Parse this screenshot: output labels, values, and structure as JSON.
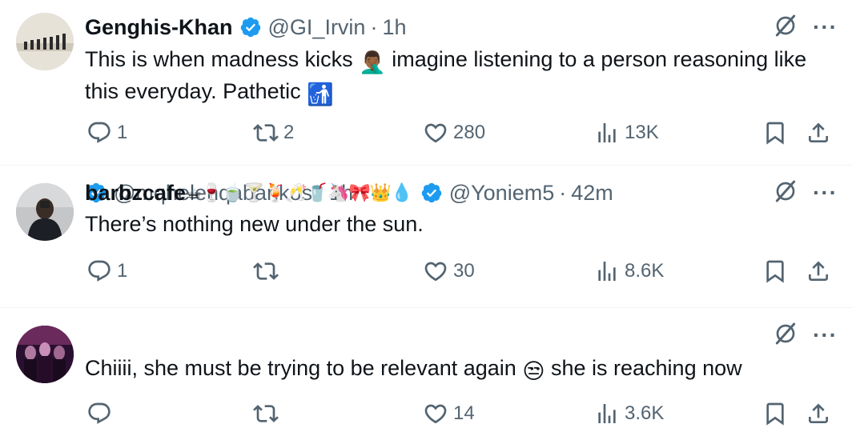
{
  "tweets": [
    {
      "name": "Genghis-Khan",
      "handle": "@GI_Irvin",
      "time": "1h",
      "text_before": "This is when madness kicks",
      "emoji_1": "🤦🏾‍♂️",
      "text_middle": "imagine listening to a person reasoning like this everyday. Pathetic",
      "emoji_2": "🚮",
      "replies": "1",
      "retweets": "2",
      "likes": "280",
      "views": "13K"
    },
    {
      "name": "",
      "handle": "@mqhelenqabankos",
      "time": "1h",
      "text": "There’s nothing new under the sun.",
      "replies": "1",
      "retweets": "",
      "likes": "30",
      "views": "8.6K"
    },
    {
      "name": "barbzcafe",
      "name_emojis": "☕🍷🍵🍸🍹🥂🥤🦄🎀👑💧",
      "handle": "@Yoniem5",
      "time": "42m",
      "text_before": "Chiiii, she must be trying to be relevant again",
      "emoji": "😒",
      "text_after": "she is reaching now",
      "replies": "",
      "retweets": "",
      "likes": "14",
      "views": "3.6K"
    }
  ],
  "colors": {
    "text": "#0f1419",
    "muted": "#536471",
    "verified": "#1d9bf0",
    "divider": "#eff3f4"
  },
  "icons": [
    "reply-icon",
    "retweet-icon",
    "like-icon",
    "views-icon",
    "bookmark-icon",
    "share-icon",
    "grok-icon",
    "more-icon",
    "verified-icon"
  ]
}
